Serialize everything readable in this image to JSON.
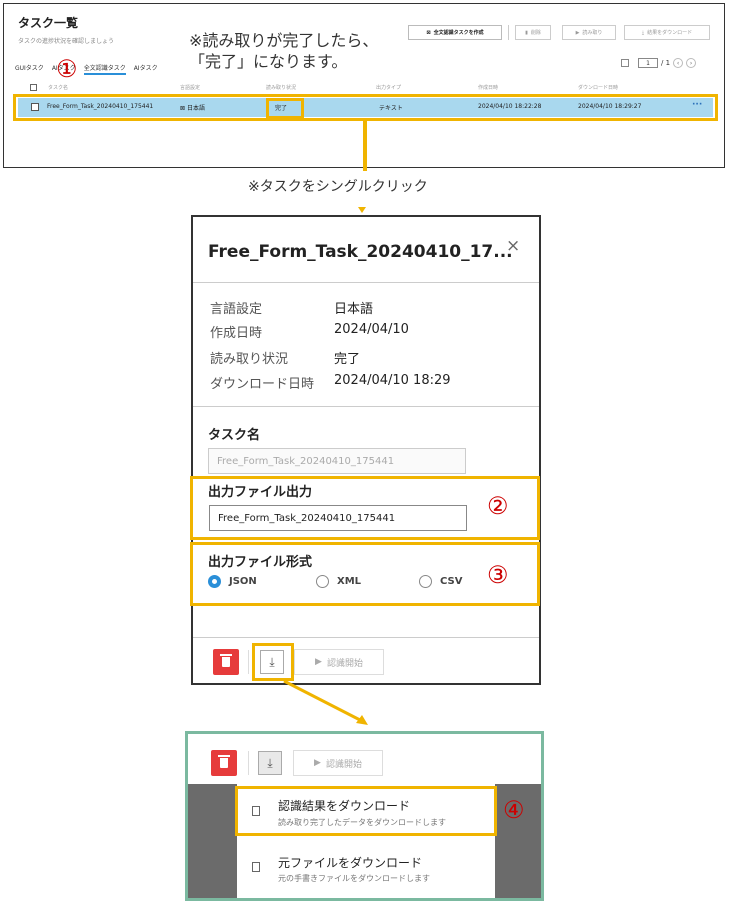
{
  "list_view": {
    "title": "タスク一覧",
    "subtitle": "タスクの進捗状況を確認しましょう",
    "tabs": [
      "GUIタスク",
      "AIタスク",
      "全文認識タスク",
      "AIタスク"
    ],
    "toolbar": {
      "create_label": "全文認識タスクを作成",
      "delete_label": "削除",
      "read_label": "読み取り",
      "download_label": "結果をダウンロード"
    },
    "pager": {
      "current": "1",
      "total": "/ 1"
    },
    "columns": {
      "name": "タスク名",
      "language": "言語設定",
      "status": "読み取り状況",
      "output_type": "出力タイプ",
      "created": "作成日時",
      "downloaded": "ダウンロード日時"
    },
    "row": {
      "name": "Free_Form_Task_20240410_175441",
      "language": "日本語",
      "status": "完了",
      "output_type": "テキスト",
      "created": "2024/04/10 18:22:28",
      "downloaded": "2024/04/10 18:29:27",
      "more": "···"
    }
  },
  "annotations": {
    "callout_line1": "※読み取りが完了したら、",
    "callout_line2": "「完了」になります。",
    "click_caption": "※タスクをシングルクリック",
    "num1": "①",
    "num2": "②",
    "num3": "③",
    "num4": "④"
  },
  "dialog": {
    "title": "Free_Form_Task_20240410_17...",
    "close": "×",
    "info": [
      {
        "label": "言語設定",
        "value": "日本語"
      },
      {
        "label": "作成日時",
        "value": "2024/04/10"
      },
      {
        "label": "読み取り状況",
        "value": "完了"
      },
      {
        "label": "ダウンロード日時",
        "value": "2024/04/10 18:29"
      }
    ],
    "task_name_title": "タスク名",
    "task_name_value": "Free_Form_Task_20240410_175441",
    "output_file_title": "出力ファイル出力",
    "output_file_value": "Free_Form_Task_20240410_175441",
    "format_title": "出力ファイル形式",
    "formats": [
      "JSON",
      "XML",
      "CSV"
    ],
    "selected_format": "JSON",
    "start_label": "認識開始"
  },
  "download_menu": {
    "start_label": "認識開始",
    "items": [
      {
        "title": "認識結果をダウンロード",
        "desc": "読み取り完了したデータをダウンロードします"
      },
      {
        "title": "元ファイルをダウンロード",
        "desc": "元の手書きファイルをダウンロードします"
      }
    ]
  },
  "colors": {
    "highlight": "#f0b400",
    "row_selected": "#a9d8ee",
    "accent_blue": "#2a8fd8",
    "delete_red": "#e63b3b",
    "frame_green": "#7bb9a0",
    "number_red": "#cc0000"
  }
}
